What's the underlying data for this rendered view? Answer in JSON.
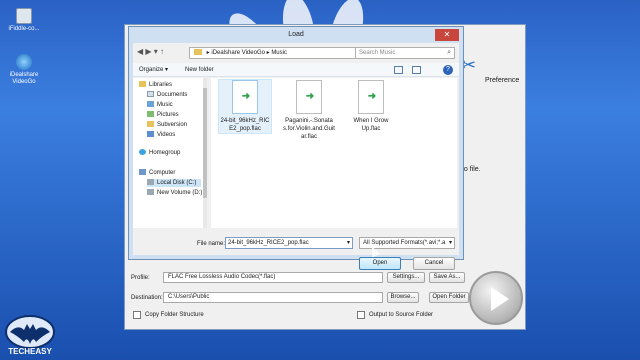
{
  "desktop": {
    "icons": [
      {
        "label": "iFiddle-co...",
        "icon": "app-icon"
      },
      {
        "label": "iDealshare VideoGo",
        "icon": "videogo-app-icon"
      }
    ],
    "watermark": "TECHEASY"
  },
  "app": {
    "preference_label": "Preference",
    "hint_text": "eo file.",
    "profile_label": "Profile:",
    "profile_value": "FLAC Free Lossless Audio Codec(*.flac)",
    "settings_button": "Settings...",
    "save_as_button": "Save As...",
    "destination_label": "Destination:",
    "destination_value": "C:\\Users\\Public",
    "browse_button": "Browse...",
    "open_folder_button": "Open Folder",
    "copy_folder_label": "Copy Folder Structure",
    "output_to_source_label": "Output to Source Folder"
  },
  "dialog": {
    "title": "Load",
    "close_glyph": "✕",
    "path": [
      "iDealshare VideoGo",
      "Music"
    ],
    "search_placeholder": "Search Music",
    "toolbar": {
      "organize": "Organize ▾",
      "new_folder": "New folder"
    },
    "tree": [
      {
        "label": "Libraries",
        "icon": "libraries-icon",
        "level": 0
      },
      {
        "label": "Documents",
        "icon": "documents-icon",
        "level": 1
      },
      {
        "label": "Music",
        "icon": "music-icon",
        "level": 1
      },
      {
        "label": "Pictures",
        "icon": "pictures-icon",
        "level": 1
      },
      {
        "label": "Subversion",
        "icon": "subversion-icon",
        "level": 1
      },
      {
        "label": "Videos",
        "icon": "videos-icon",
        "level": 1
      },
      {
        "label": "Homegroup",
        "icon": "homegroup-icon",
        "level": 0
      },
      {
        "label": "Computer",
        "icon": "computer-icon",
        "level": 0
      },
      {
        "label": "Local Disk (C:)",
        "icon": "local-disk-icon",
        "level": 1
      },
      {
        "label": "New Volume (D:)",
        "icon": "drive-icon",
        "level": 1
      }
    ],
    "files": [
      {
        "name": "24-bit_96kHz_RICE2_pop.flac"
      },
      {
        "name": "Paganini.-.Sonatas.for.Violin.and.Guitar.flac"
      },
      {
        "name": "When I Grow Up.flac"
      }
    ],
    "file_name_label": "File name:",
    "file_name_value": "24-bit_96kHz_RICE2_pop.flac",
    "filter_value": "All Supported Formats(*.avi;*.a",
    "open_button": "Open",
    "cancel_button": "Cancel"
  }
}
